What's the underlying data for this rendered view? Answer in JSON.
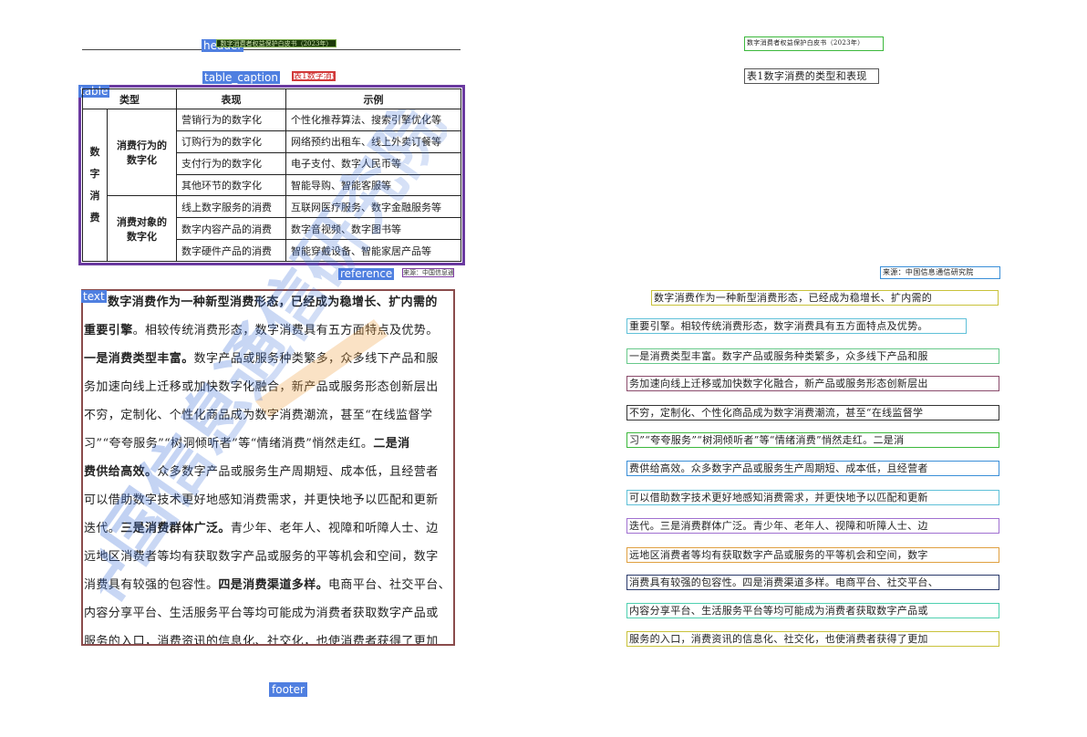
{
  "layout_tags": {
    "header": "header",
    "table_caption": "table_caption",
    "table": "table",
    "reference": "reference",
    "text": "text",
    "footer": "footer"
  },
  "header_text": "数字消费者权益保护白皮书（2023年）",
  "caption_text": "表1数字消费的类型和表现",
  "table": {
    "headers": [
      "类型",
      "表现",
      "示例"
    ],
    "root_label": "数字消费",
    "groups": [
      {
        "name": "消费行为的数字化",
        "rows": [
          [
            "营销行为的数字化",
            "个性化推荐算法、搜索引擎优化等"
          ],
          [
            "订购行为的数字化",
            "网络预约出租车、线上外卖订餐等"
          ],
          [
            "支付行为的数字化",
            "电子支付、数字人民币等"
          ],
          [
            "其他环节的数字化",
            "智能导购、智能客服等"
          ]
        ]
      },
      {
        "name": "消费对象的数字化",
        "rows": [
          [
            "线上数字服务的消费",
            "互联网医疗服务、数字金融服务等"
          ],
          [
            "数字内容产品的消费",
            "数字音视频、数字图书等"
          ],
          [
            "数字硬件产品的消费",
            "智能穿戴设备、智能家居产品等"
          ]
        ]
      }
    ]
  },
  "reference_text": "来源：中国信息通信研究院",
  "watermark_text": "中国信息通信研究院",
  "body_lines": [
    [
      {
        "t": "数字消费作为一种新型消费形态，已经成为稳增长、扩内需的",
        "b": true
      }
    ],
    [
      {
        "t": "重要引擎",
        "b": true
      },
      {
        "t": "。相较传统消费形态，数字消费具有五方面特点及优势。"
      }
    ],
    [
      {
        "t": "一是消费类型丰富。",
        "b": true
      },
      {
        "t": "数字产品或服务种类繁多，众多线下产品和服"
      }
    ],
    [
      {
        "t": "务加速向线上迁移或加快数字化融合，新产品或服务形态创新层出"
      }
    ],
    [
      {
        "t": "不穷，定制化、个性化商品成为数字消费潮流，甚至“在线监督学"
      }
    ],
    [
      {
        "t": "习”“夸夸服务”“树洞倾听者”等“情绪消费”悄然走红。"
      },
      {
        "t": "二是消",
        "b": true
      }
    ],
    [
      {
        "t": "费供给高效。",
        "b": true
      },
      {
        "t": "众多数字产品或服务生产周期短、成本低，且经营者"
      }
    ],
    [
      {
        "t": "可以借助数字技术更好地感知消费需求，并更快地予以匹配和更新"
      }
    ],
    [
      {
        "t": "迭代。"
      },
      {
        "t": "三是消费群体广泛。",
        "b": true
      },
      {
        "t": "青少年、老年人、视障和听障人士、边"
      }
    ],
    [
      {
        "t": "远地区消费者等均有获取数字产品或服务的平等机会和空间，数字"
      }
    ],
    [
      {
        "t": "消费具有较强的包容性。"
      },
      {
        "t": "四是消费渠道多样。",
        "b": true
      },
      {
        "t": "电商平台、社交平台、"
      }
    ],
    [
      {
        "t": "内容分享平台、生活服务平台等均可能成为消费者获取数字产品或"
      }
    ],
    [
      {
        "t": "服务的入口，消费资讯的信息化、社交化，也使消费者获得了更加"
      }
    ]
  ],
  "right_lines": [
    "数字消费作为一种新型消费形态，已经成为稳增长、扩内需的",
    "重要引擎。相较传统消费形态，数字消费具有五方面特点及优势。",
    "一是消费类型丰富。数字产品或服务种类繁多，众多线下产品和服",
    "务加速向线上迁移或加快数字化融合，新产品或服务形态创新层出",
    "不穷，定制化、个性化商品成为数字消费潮流，甚至“在线监督学",
    "习”“夸夸服务”“树洞倾听者”等“情绪消费”悄然走红。二是消",
    "费供给高效。众多数字产品或服务生产周期短、成本低，且经营者",
    "可以借助数字技术更好地感知消费需求，并更快地予以匹配和更新",
    "迭代。三是消费群体广泛。青少年、老年人、视障和听障人士、边",
    "远地区消费者等均有获取数字产品或服务的平等机会和空间，数字",
    "消费具有较强的包容性。四是消费渠道多样。电商平台、社交平台、",
    "内容分享平台、生活服务平台等均可能成为消费者获取数字产品或",
    "服务的入口，消费资讯的信息化、社交化，也使消费者获得了更加"
  ],
  "colors": {
    "tag_bg": "#4f7fe0",
    "table_frame": "#6b3aa0",
    "text_frame": "#8a4b4b",
    "caption_frame": "#d23a3a",
    "watermark": "#3b6fd8"
  }
}
